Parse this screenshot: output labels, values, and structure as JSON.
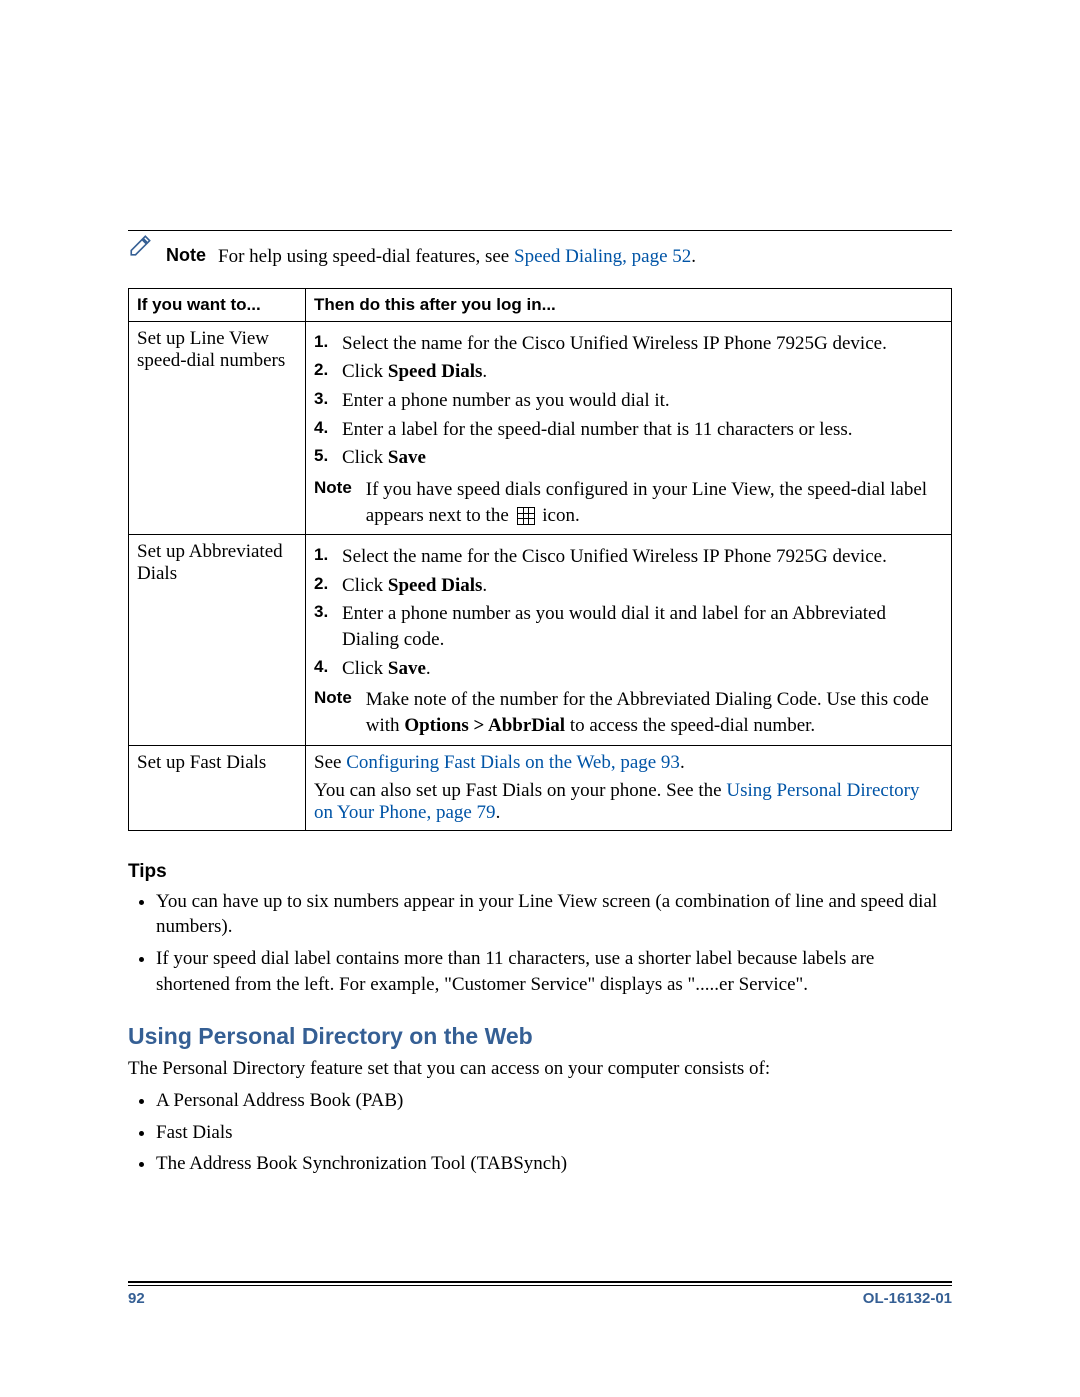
{
  "note": {
    "label": "Note",
    "text_prefix": "For help using speed-dial features, see ",
    "link": "Speed Dialing, page 52",
    "suffix": "."
  },
  "table": {
    "header_left": "If you want to...",
    "header_right": "Then do this after you log in...",
    "rows": [
      {
        "task": "Set up Line View speed-dial numbers",
        "steps": [
          "Select the name for the Cisco Unified Wireless IP Phone 7925G device.",
          {
            "prefix": "Click ",
            "bold": "Speed Dials",
            "suffix": "."
          },
          "Enter a phone number as you would dial it.",
          "Enter a label for the speed-dial number that is 11 characters or less.",
          {
            "prefix": "Click ",
            "bold": "Save",
            "suffix": ""
          }
        ],
        "note": {
          "label": "Note",
          "text_before": "If you have speed dials configured in your Line View, the speed-dial label appears next to the ",
          "text_after": " icon."
        }
      },
      {
        "task": "Set up Abbreviated Dials",
        "steps": [
          "Select the name for the Cisco Unified Wireless IP Phone 7925G device.",
          {
            "prefix": "Click ",
            "bold": "Speed Dials",
            "suffix": "."
          },
          "Enter a phone number as you would dial it and label for an Abbreviated Dialing code.",
          {
            "prefix": "Click ",
            "bold": "Save",
            "suffix": "."
          }
        ],
        "note": {
          "label": "Note",
          "text_before": "Make note of the number for the Abbreviated Dialing Code. Use this code with ",
          "bold": "Options > AbbrDial",
          "text_after": " to access the speed-dial number."
        }
      },
      {
        "task": "Set up Fast Dials",
        "line1_prefix": "See ",
        "line1_link": "Configuring Fast Dials on the Web, page 93",
        "line1_suffix": ".",
        "line2_prefix": "You can also set up Fast Dials on your phone. See the ",
        "line2_link": "Using Personal Directory on Your Phone, page 79",
        "line2_suffix": "."
      }
    ]
  },
  "tips": {
    "heading": "Tips",
    "items": [
      "You can have up to six numbers appear in your Line View screen (a combination of line and speed dial numbers).",
      "If your speed dial label contains more than 11 characters, use a shorter label because labels are shortened from the left. For example, \"Customer Service\" displays as \".....er Service\"."
    ]
  },
  "section": {
    "heading": "Using Personal Directory on the Web",
    "intro": "The Personal Directory feature set that you can access on your computer consists of:",
    "items": [
      "A Personal Address Book (PAB)",
      "Fast Dials",
      "The Address Book Synchronization Tool (TABSynch)"
    ]
  },
  "footer": {
    "page_number": "92",
    "doc_id": "OL-16132-01"
  }
}
